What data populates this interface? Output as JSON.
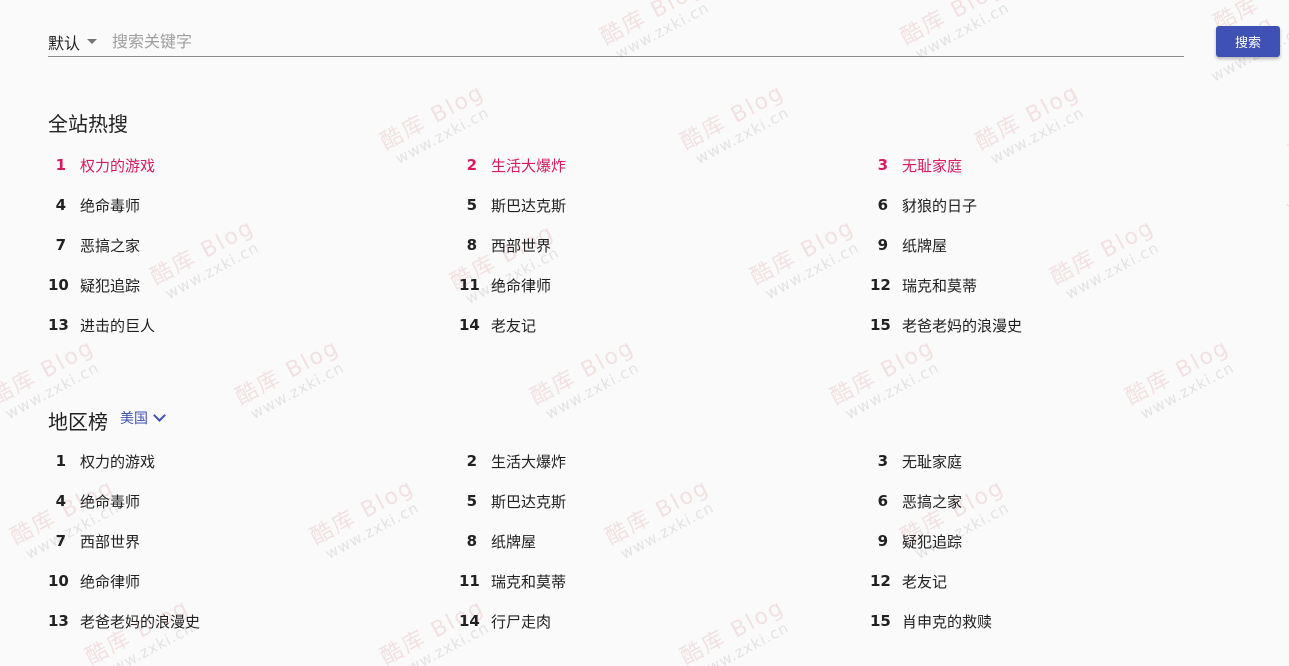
{
  "search": {
    "sort_label": "默认",
    "placeholder": "搜索关键字",
    "value": "",
    "button_label": "搜索"
  },
  "hot": {
    "title": "全站热搜",
    "highlight_color": "#d81b60",
    "items": [
      {
        "rank": "1",
        "title": "权力的游戏"
      },
      {
        "rank": "2",
        "title": "生活大爆炸"
      },
      {
        "rank": "3",
        "title": "无耻家庭"
      },
      {
        "rank": "4",
        "title": "绝命毒师"
      },
      {
        "rank": "5",
        "title": "斯巴达克斯"
      },
      {
        "rank": "6",
        "title": "豺狼的日子"
      },
      {
        "rank": "7",
        "title": "恶搞之家"
      },
      {
        "rank": "8",
        "title": "西部世界"
      },
      {
        "rank": "9",
        "title": "纸牌屋"
      },
      {
        "rank": "10",
        "title": "疑犯追踪"
      },
      {
        "rank": "11",
        "title": "绝命律师"
      },
      {
        "rank": "12",
        "title": "瑞克和莫蒂"
      },
      {
        "rank": "13",
        "title": "进击的巨人"
      },
      {
        "rank": "14",
        "title": "老友记"
      },
      {
        "rank": "15",
        "title": "老爸老妈的浪漫史"
      }
    ]
  },
  "region": {
    "title": "地区榜",
    "selected": "美国",
    "accent_color": "#3f51b5",
    "items": [
      {
        "rank": "1",
        "title": "权力的游戏"
      },
      {
        "rank": "2",
        "title": "生活大爆炸"
      },
      {
        "rank": "3",
        "title": "无耻家庭"
      },
      {
        "rank": "4",
        "title": "绝命毒师"
      },
      {
        "rank": "5",
        "title": "斯巴达克斯"
      },
      {
        "rank": "6",
        "title": "恶搞之家"
      },
      {
        "rank": "7",
        "title": "西部世界"
      },
      {
        "rank": "8",
        "title": "纸牌屋"
      },
      {
        "rank": "9",
        "title": "疑犯追踪"
      },
      {
        "rank": "10",
        "title": "绝命律师"
      },
      {
        "rank": "11",
        "title": "瑞克和莫蒂"
      },
      {
        "rank": "12",
        "title": "老友记"
      },
      {
        "rank": "13",
        "title": "老爸老妈的浪漫史"
      },
      {
        "rank": "14",
        "title": "行尸走肉"
      },
      {
        "rank": "15",
        "title": "肖申克的救赎"
      }
    ]
  },
  "watermark": {
    "line1": "酷库 Blog",
    "line2": "www.zxki.cn"
  }
}
